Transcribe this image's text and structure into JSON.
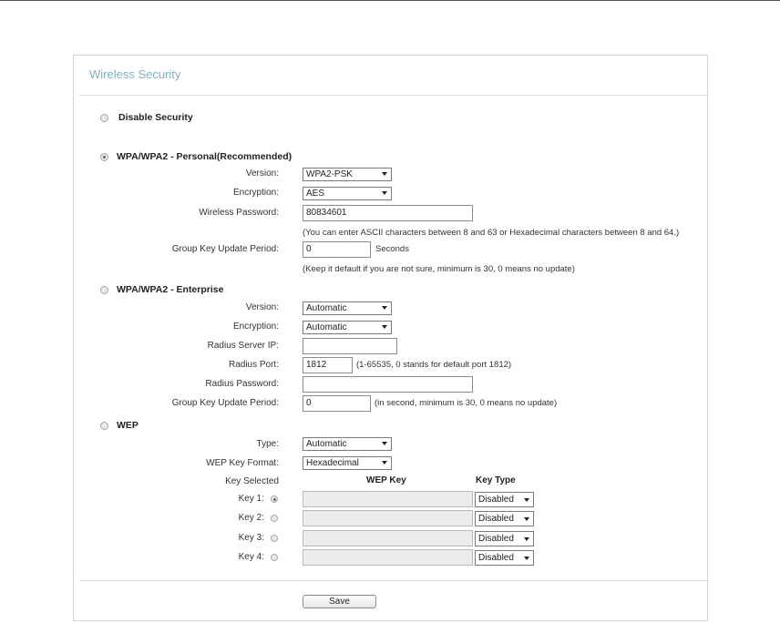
{
  "title": "Wireless Security",
  "disable": {
    "label": "Disable Security",
    "selected": false
  },
  "personal": {
    "label": "WPA/WPA2 - Personal(Recommended)",
    "selected": true,
    "version_label": "Version:",
    "version_value": "WPA2-PSK",
    "encryption_label": "Encryption:",
    "encryption_value": "AES",
    "password_label": "Wireless Password:",
    "password_value": "80834601",
    "password_hint": "(You can enter ASCII characters between 8 and 63 or Hexadecimal characters between 8 and 64.)",
    "group_label": "Group Key Update Period:",
    "group_value": "0",
    "group_unit": "Seconds",
    "group_hint": "(Keep it default if you are not sure, minimum is 30, 0 means no update)"
  },
  "enterprise": {
    "label": "WPA/WPA2 - Enterprise",
    "selected": false,
    "version_label": "Version:",
    "version_value": "Automatic",
    "encryption_label": "Encryption:",
    "encryption_value": "Automatic",
    "server_label": "Radius Server IP:",
    "server_value": "",
    "port_label": "Radius Port:",
    "port_value": "1812",
    "port_hint": "(1-65535, 0 stands for default port 1812)",
    "radius_pw_label": "Radius Password:",
    "radius_pw_value": "",
    "group_label": "Group Key Update Period:",
    "group_value": "0",
    "group_hint": "(in second, minimum is 30, 0 means no update)"
  },
  "wep": {
    "label": "WEP",
    "selected": false,
    "type_label": "Type:",
    "type_value": "Automatic",
    "format_label": "WEP Key Format:",
    "format_value": "Hexadecimal",
    "key_selected_header": "Key Selected",
    "wep_key_header": "WEP Key",
    "key_type_header": "Key Type",
    "keys": [
      {
        "label": "Key 1:",
        "selected": true,
        "value": "",
        "type": "Disabled"
      },
      {
        "label": "Key 2:",
        "selected": false,
        "value": "",
        "type": "Disabled"
      },
      {
        "label": "Key 3:",
        "selected": false,
        "value": "",
        "type": "Disabled"
      },
      {
        "label": "Key 4:",
        "selected": false,
        "value": "",
        "type": "Disabled"
      }
    ]
  },
  "save_label": "Save"
}
